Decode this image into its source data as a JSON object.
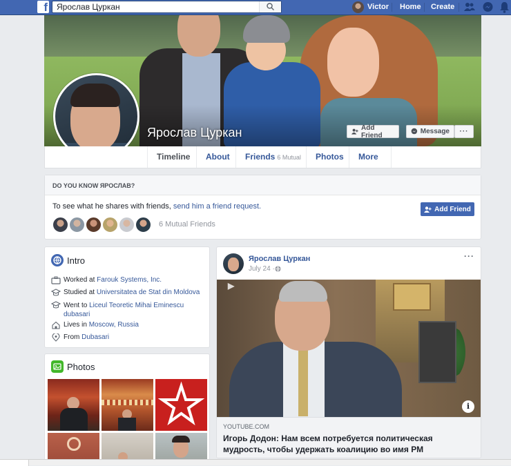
{
  "topbar": {
    "logo": "f",
    "search_value": "Ярослав Цуркан",
    "user_name": "Victor",
    "home_label": "Home",
    "create_label": "Create",
    "icons": [
      "friends-icon",
      "messenger-icon",
      "notifications-icon"
    ]
  },
  "cover": {
    "name": "Ярослав Цуркан",
    "add_friend_label": "Add Friend",
    "message_label": "Message",
    "more_label": "···"
  },
  "tabs": [
    {
      "label": "Timeline",
      "sub": ""
    },
    {
      "label": "About",
      "sub": ""
    },
    {
      "label": "Friends",
      "sub": "6 Mutual"
    },
    {
      "label": "Photos",
      "sub": ""
    },
    {
      "label": "More",
      "sub": ""
    }
  ],
  "know": {
    "heading": "Do you know Ярослав?",
    "text_prefix": "To see what he shares with friends, ",
    "text_link": "send him a friend request.",
    "button_label": "Add Friend",
    "mutual_count": "6 Mutual Friends"
  },
  "intro": {
    "title": "Intro",
    "items": [
      {
        "icon": "work-icon",
        "prefix": "Worked at ",
        "link": "Farouk Systems, Inc.",
        "suffix": ""
      },
      {
        "icon": "education-icon",
        "prefix": "Studied at ",
        "link": "Universitatea de Stat din Moldova",
        "suffix": ""
      },
      {
        "icon": "education-icon",
        "prefix": "Went to ",
        "link": "Liceul Teoretic Mihai Eminescu dubasari",
        "suffix": ""
      },
      {
        "icon": "home-icon",
        "prefix": "Lives in ",
        "link": "Moscow, Russia",
        "suffix": ""
      },
      {
        "icon": "location-icon",
        "prefix": "From ",
        "link": "Dubasari",
        "suffix": ""
      }
    ]
  },
  "photos": {
    "title": "Photos"
  },
  "post": {
    "author": "Ярослав Цуркан",
    "date": "July 24 · ",
    "more": "···",
    "source": "YOUTUBE.COM",
    "headline": "Игорь Додон: Нам всем потребуется политическая мудрость, чтобы удержать коалицию во имя РМ"
  },
  "colors": {
    "brand": "#4267b2",
    "link": "#365899",
    "page_bg": "#e9ebee"
  }
}
